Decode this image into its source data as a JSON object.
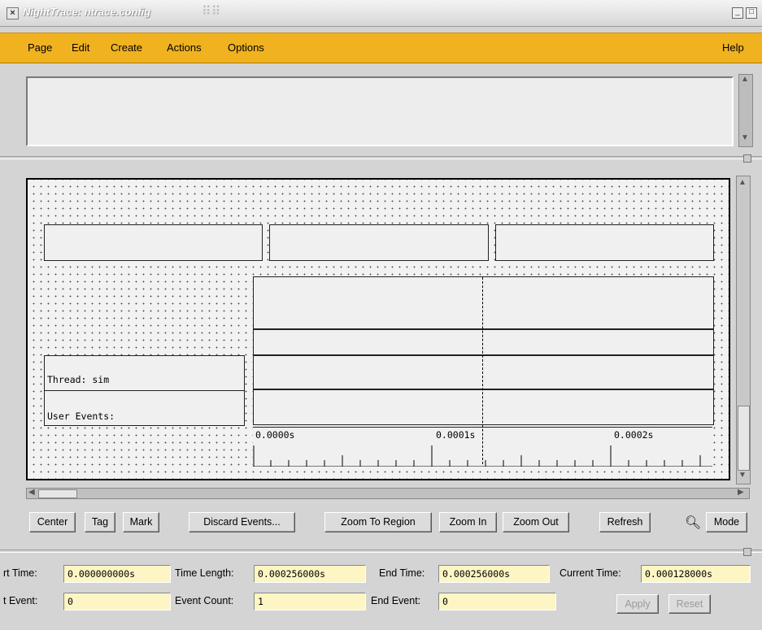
{
  "window": {
    "title": "NightTrace: ntrace.config"
  },
  "menubar": {
    "items": [
      "Page",
      "Edit",
      "Create",
      "Actions",
      "Options"
    ],
    "help": "Help"
  },
  "canvas": {
    "thread_label": "Thread: sim",
    "user_events_label": "User Events:",
    "ruler_labels": [
      "0.0000s",
      "0.0001s",
      "0.0002s"
    ]
  },
  "toolbar": {
    "center": "Center",
    "tag": "Tag",
    "mark": "Mark",
    "discard": "Discard Events...",
    "zoom_region": "Zoom To Region",
    "zoom_in": "Zoom In",
    "zoom_out": "Zoom Out",
    "refresh": "Refresh",
    "mode": "Mode"
  },
  "fields": {
    "start_time_label": "rt Time:",
    "start_time_value": "0.000000000s",
    "time_length_label": "Time Length:",
    "time_length_value": "0.000256000s",
    "end_time_label": "End Time:",
    "end_time_value": "0.000256000s",
    "current_time_label": "Current Time:",
    "current_time_value": "0.000128000s",
    "start_event_label": "t Event:",
    "start_event_value": "0",
    "event_count_label": "Event Count:",
    "event_count_value": "1",
    "end_event_label": "End Event:",
    "end_event_value": "0",
    "apply": "Apply",
    "reset": "Reset"
  },
  "colors": {
    "menubar": "#f0b21f",
    "field": "#fdf6c4"
  }
}
